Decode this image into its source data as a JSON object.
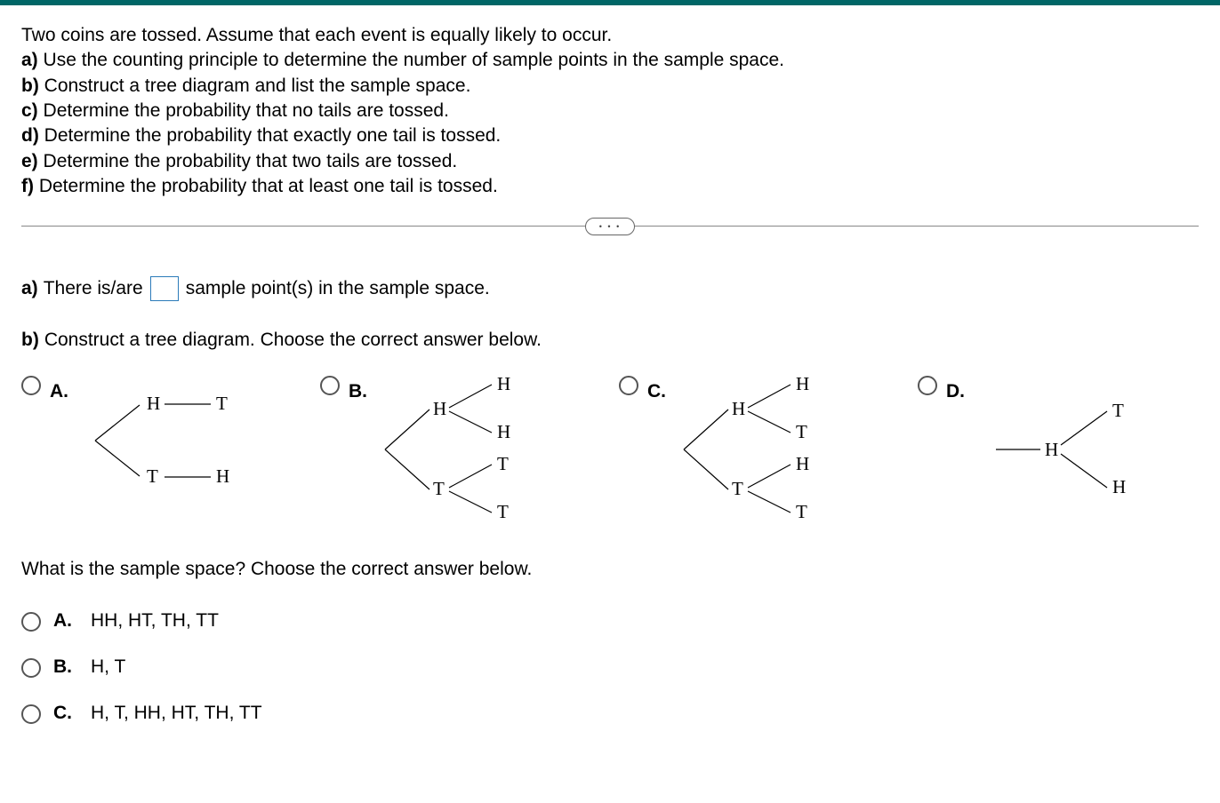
{
  "question": {
    "intro": "Two coins are tossed. Assume that each event is equally likely to occur.",
    "a_label": "a)",
    "a_text": " Use the counting principle to determine the number of sample points in the sample space.",
    "b_label": "b)",
    "b_text": " Construct a tree diagram and list the sample space.",
    "c_label": "c)",
    "c_text": " Determine the probability that no tails are tossed.",
    "d_label": "d)",
    "d_text": " Determine the probability that exactly one tail is tossed.",
    "e_label": "e)",
    "e_text": " Determine the probability that two tails are tossed.",
    "f_label": "f)",
    "f_text": " Determine the probability that at least one tail is tossed."
  },
  "answers": {
    "a_label": "a)",
    "a_before": " There is/are ",
    "a_after": " sample point(s) in the sample space.",
    "b_label": "b)",
    "b_text": " Construct a tree diagram. Choose the correct answer below.",
    "tree_labels": {
      "A": "A.",
      "B": "B.",
      "C": "C.",
      "D": "D."
    },
    "tree_A": {
      "l1": "H",
      "l1r": "T",
      "l2": "T",
      "l2r": "H"
    },
    "tree_B": {
      "b1": "H",
      "b2": "T",
      "l1": "H",
      "l2": "H",
      "l3": "T",
      "l4": "T"
    },
    "tree_C": {
      "b1": "H",
      "b2": "T",
      "l1": "H",
      "l2": "T",
      "l3": "H",
      "l4": "T"
    },
    "tree_D": {
      "b1": "H",
      "l1": "T",
      "l2": "H"
    },
    "ss_prompt": "What is the sample space? Choose the correct answer below.",
    "ss_options": {
      "A_label": "A.",
      "A": "HH, HT, TH, TT",
      "B_label": "B.",
      "B": "H, T",
      "C_label": "C.",
      "C": "H, T, HH, HT, TH, TT"
    }
  }
}
